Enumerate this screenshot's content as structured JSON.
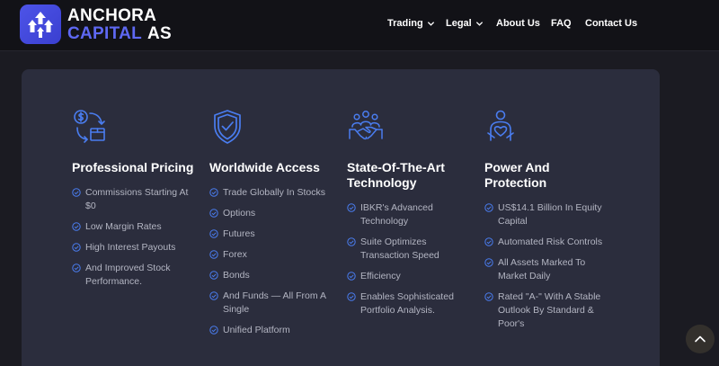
{
  "brand": {
    "line1": "ANCHORA",
    "line2a": "CAPITAL",
    "line2b": "AS",
    "accent_color": "#5e68f2",
    "logo_icon": "arrows-up-icon"
  },
  "nav": {
    "items": [
      {
        "label": "Trading",
        "has_dropdown": true
      },
      {
        "label": "Legal",
        "has_dropdown": true
      },
      {
        "label": "About Us",
        "has_dropdown": false
      },
      {
        "label": "FAQ",
        "has_dropdown": false
      },
      {
        "label": "Contact Us",
        "has_dropdown": false
      }
    ]
  },
  "features": [
    {
      "icon": "dollar-exchange-icon",
      "title_line1": "Professional Pricing",
      "title_line2": "",
      "items": [
        {
          "line1": "Commissions Starting At",
          "line2": "$0"
        },
        {
          "line1": "Low Margin Rates",
          "line2": ""
        },
        {
          "line1": "High Interest Payouts",
          "line2": ""
        },
        {
          "line1": "And Improved Stock",
          "line2": "Performance."
        }
      ]
    },
    {
      "icon": "shield-check-icon",
      "title_line1": "Worldwide Access",
      "title_line2": "",
      "items": [
        {
          "line1": "Trade Globally In Stocks",
          "line2": ""
        },
        {
          "line1": "Options",
          "line2": ""
        },
        {
          "line1": "Futures",
          "line2": ""
        },
        {
          "line1": "Forex",
          "line2": ""
        },
        {
          "line1": "Bonds",
          "line2": ""
        },
        {
          "line1": "And Funds — All From A",
          "line2": "Single"
        },
        {
          "line1": "Unified Platform",
          "line2": ""
        }
      ]
    },
    {
      "icon": "handshake-team-icon",
      "title_line1": "State-Of-The-Art",
      "title_line2": "Technology",
      "items": [
        {
          "line1": "IBKR's Advanced",
          "line2": "Technology"
        },
        {
          "line1": "Suite Optimizes",
          "line2": "Transaction Speed"
        },
        {
          "line1": "Efficiency",
          "line2": ""
        },
        {
          "line1": "Enables Sophisticated",
          "line2": "Portfolio Analysis."
        }
      ]
    },
    {
      "icon": "person-heart-icon",
      "title_line1": "Power And",
      "title_line2": "Protection",
      "items": [
        {
          "line1": "US$14.1 Billion In Equity",
          "line2": "Capital"
        },
        {
          "line1": "Automated Risk Controls",
          "line2": ""
        },
        {
          "line1": "All Assets Marked To",
          "line2": "Market Daily"
        },
        {
          "line1": "Rated \"A-\" With A Stable",
          "line2": "Outlook By Standard &",
          "line3": "Poor's"
        }
      ]
    }
  ],
  "colors": {
    "icon_blue": "#4a7df0",
    "panel_bg": "#2b2d3d",
    "page_bg": "#1b1b22",
    "body_text": "#b3b5c2"
  },
  "scroll_top": {
    "icon": "chevron-up-icon"
  }
}
